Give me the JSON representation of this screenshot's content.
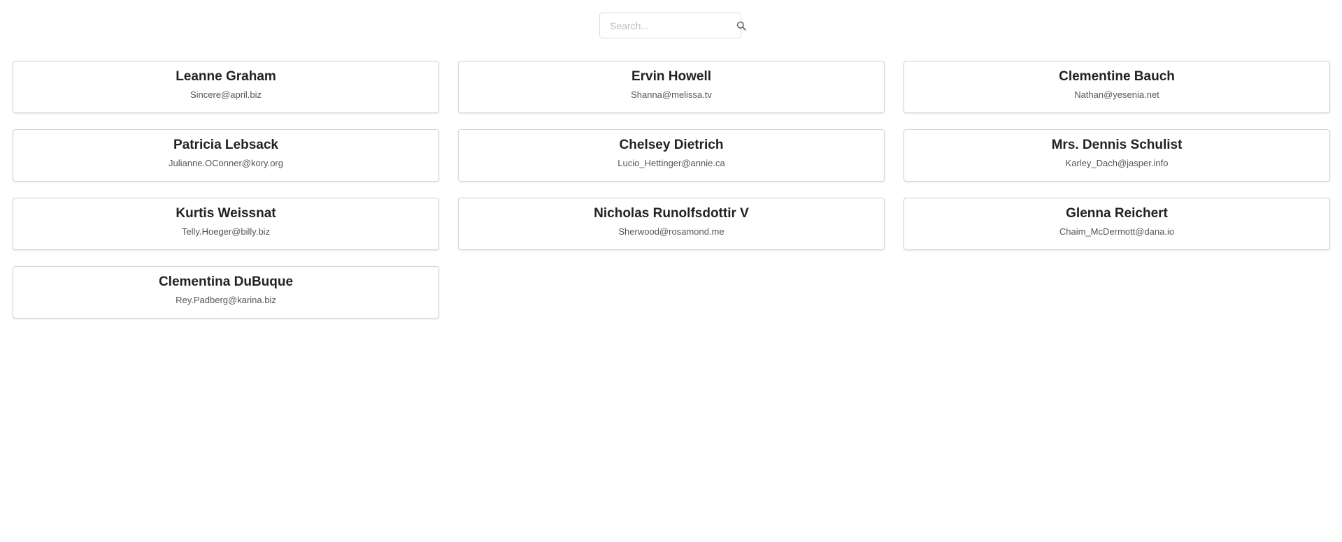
{
  "search": {
    "placeholder": "Search..."
  },
  "users": [
    {
      "name": "Leanne Graham",
      "email": "Sincere@april.biz"
    },
    {
      "name": "Ervin Howell",
      "email": "Shanna@melissa.tv"
    },
    {
      "name": "Clementine Bauch",
      "email": "Nathan@yesenia.net"
    },
    {
      "name": "Patricia Lebsack",
      "email": "Julianne.OConner@kory.org"
    },
    {
      "name": "Chelsey Dietrich",
      "email": "Lucio_Hettinger@annie.ca"
    },
    {
      "name": "Mrs. Dennis Schulist",
      "email": "Karley_Dach@jasper.info"
    },
    {
      "name": "Kurtis Weissnat",
      "email": "Telly.Hoeger@billy.biz"
    },
    {
      "name": "Nicholas Runolfsdottir V",
      "email": "Sherwood@rosamond.me"
    },
    {
      "name": "Glenna Reichert",
      "email": "Chaim_McDermott@dana.io"
    },
    {
      "name": "Clementina DuBuque",
      "email": "Rey.Padberg@karina.biz"
    }
  ]
}
